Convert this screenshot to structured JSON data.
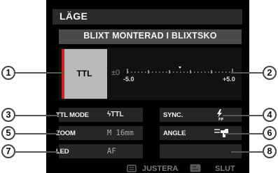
{
  "header": {
    "title": "LÄGE"
  },
  "flash": {
    "mode_text": "BLIXT MONTERAD I BLIXTSKO"
  },
  "panel": {
    "mode_label": "TTL",
    "compensation": "±0",
    "scale_min_label": "-5.0",
    "scale_max_label": "+5.0"
  },
  "settings": {
    "ttl_mode_label": "TTL MODE",
    "ttl_mode_value": "ϟTTL",
    "sync_label": "SYNC.",
    "sync_value_icon": "flash-fp-icon",
    "zoom_label": "ZOOM",
    "zoom_value": "M 16mm",
    "angle_label": "ANGLE",
    "angle_value_icon": "flash-angle-icon",
    "led_label": "LED",
    "led_value": "AF"
  },
  "footer": {
    "adjust_icon": "menu-icon",
    "adjust_label": "JUSTERA",
    "back_icon": "back-icon",
    "back_label": "SLUT"
  },
  "callouts": [
    "1",
    "2",
    "3",
    "4",
    "5",
    "6",
    "7",
    "8"
  ],
  "colors": {
    "accent_red": "#d01e1e",
    "screen_bg": "#000000",
    "cell_bg": "#262626"
  }
}
